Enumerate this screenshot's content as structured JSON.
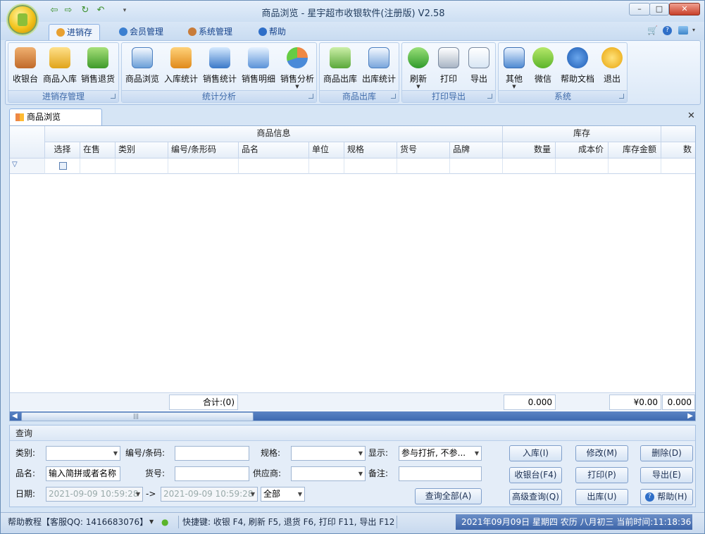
{
  "window": {
    "title": "商品浏览 - 星宇超市收银软件(注册版) V2.58"
  },
  "ribbon_tabs": [
    {
      "label": "进销存",
      "icon": "stock-icon",
      "active": true
    },
    {
      "label": "会员管理",
      "icon": "member-icon"
    },
    {
      "label": "系统管理",
      "icon": "tools-icon"
    },
    {
      "label": "帮助",
      "icon": "help-icon"
    }
  ],
  "groups": [
    {
      "caption": "进销存管理",
      "buttons": [
        "收银台",
        "商品入库",
        "销售退货"
      ]
    },
    {
      "caption": "统计分析",
      "buttons": [
        "商品浏览",
        "入库统计",
        "销售统计",
        "销售明细",
        "销售分析"
      ]
    },
    {
      "caption": "商品出库",
      "buttons": [
        "商品出库",
        "出库统计"
      ]
    },
    {
      "caption": "打印导出",
      "buttons": [
        "刷新",
        "打印",
        "导出"
      ]
    },
    {
      "caption": "系统",
      "buttons": [
        "其他",
        "微信",
        "帮助文档",
        "退出"
      ]
    }
  ],
  "doc_tab": {
    "label": "商品浏览"
  },
  "grid": {
    "band_goods": "商品信息",
    "band_stock": "库存",
    "columns": [
      "选择",
      "在售",
      "类别",
      "编号/条形码",
      "品名",
      "单位",
      "规格",
      "货号",
      "品牌",
      "数量",
      "成本价",
      "库存金额",
      "数"
    ],
    "summary": {
      "count": "合计:(0)",
      "quantity": "0.000",
      "amount": "¥0.00",
      "last": "0.000"
    }
  },
  "query": {
    "title": "查询",
    "labels": {
      "category": "类别:",
      "code": "编号/条码:",
      "spec": "规格:",
      "display": "显示:",
      "name": "品名:",
      "item_no": "货号:",
      "supplier": "供应商:",
      "remark": "备注:",
      "date": "日期:",
      "arrow": "->"
    },
    "name_value": "输入简拼或者名称",
    "display_value": "参与打折, 不参...",
    "date_from": "2021-09-09 10:59:28",
    "date_to": "2021-09-09 10:59:28",
    "range_value": "全部",
    "buttons": {
      "query_all": "查询全部(A)",
      "stock_in": "入库(I)",
      "edit": "修改(M)",
      "delete": "删除(D)",
      "cashier": "收银台(F4)",
      "print": "打印(P)",
      "export": "导出(E)",
      "advanced": "高级查询(Q)",
      "stock_out": "出库(U)",
      "help": "帮助(H)"
    }
  },
  "status": {
    "help": "帮助教程【客服QQ: 1416683076】",
    "shortcuts": "快捷键: 收银 F4, 刷新 F5, 退货 F6, 打印 F11, 导出 F12",
    "datetime": "2021年09月09日 星期四 农历 八月初三 当前时间:11:18:36"
  }
}
